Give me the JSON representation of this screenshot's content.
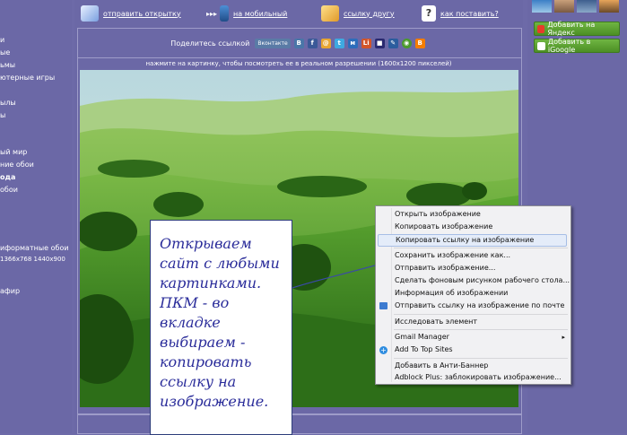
{
  "left_nav": {
    "items": [
      {
        "label": "и"
      },
      {
        "label": "ые"
      },
      {
        "label": "ьмы"
      },
      {
        "label": "ютерные игры"
      },
      {
        "label": "ылы"
      },
      {
        "label": "ы"
      },
      {
        "label": "ый мир"
      },
      {
        "label": "ние обои"
      },
      {
        "label": "ода"
      },
      {
        "label": "обои"
      },
      {
        "label": "иформатные обои"
      },
      {
        "label": "1366x768  1440x900"
      },
      {
        "label": "афир"
      }
    ]
  },
  "top_links": {
    "send_postcard": "отправить открытку",
    "to_mobile": "на мобильный",
    "link_to_friend": "ссылку другу",
    "how_to_set": "как поставить?"
  },
  "share": {
    "label": "Поделитесь ссылкой",
    "vk_button": "Вконтакте",
    "icons": [
      "vk",
      "facebook",
      "mail",
      "twitter",
      "myworld",
      "liveinternet",
      "delicious",
      "livejournal",
      "google",
      "blogger"
    ]
  },
  "caption": "нажмите на картинку, чтобы посмотреть ее в реальном разрешении (1600x1200 пикселей)",
  "right_panel": {
    "add_yandex": "Добавить на Яндекс",
    "add_igoogle": "Добавить в iGoogle"
  },
  "context_menu": {
    "items": [
      {
        "label": "Открыть изображение"
      },
      {
        "label": "Копировать изображение"
      },
      {
        "label": "Копировать ссылку на изображение"
      },
      {
        "label": "Сохранить изображение как..."
      },
      {
        "label": "Отправить изображение..."
      },
      {
        "label": "Сделать фоновым рисунком рабочего стола..."
      },
      {
        "label": "Информация об изображении"
      },
      {
        "label": "Отправить ссылку на изображение по почте"
      },
      {
        "label": "Исследовать элемент"
      },
      {
        "label": "Gmail Manager"
      },
      {
        "label": "Add To Top Sites"
      },
      {
        "label": "Добавить в Анти-Баннер"
      },
      {
        "label": "Adblock Plus: заблокировать изображение..."
      }
    ]
  },
  "annotation": {
    "text": "Открываем сайт с любыми картинками. ПКМ - во вкладке выбираем - копировать ссылку на изображение."
  },
  "colors": {
    "page_bg": "#6b68a6",
    "button_green": "#5aa232",
    "menu_bg": "#f1f1f3",
    "annotation_text": "#2a2c9a"
  }
}
